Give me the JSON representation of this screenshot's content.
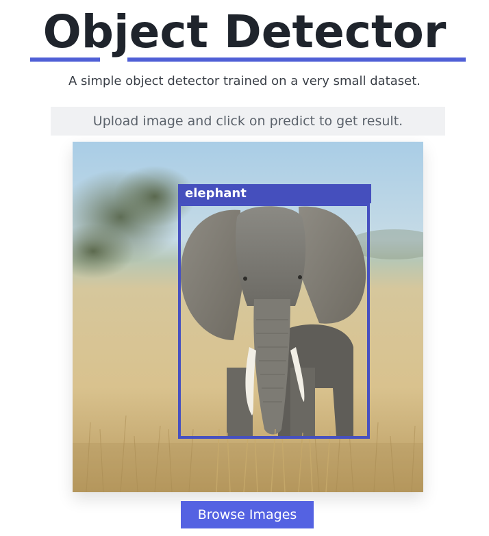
{
  "header": {
    "title": "Object Detector",
    "subtitle": "A simple object detector trained on a very small dataset."
  },
  "instructions": {
    "text": "Upload image and click on predict to get result."
  },
  "result": {
    "detections": [
      {
        "label": "elephant"
      }
    ]
  },
  "actions": {
    "browse_label": "Browse Images"
  },
  "colors": {
    "accent": "#5462e2",
    "bbox": "#4650c0",
    "title": "#1f242c"
  }
}
